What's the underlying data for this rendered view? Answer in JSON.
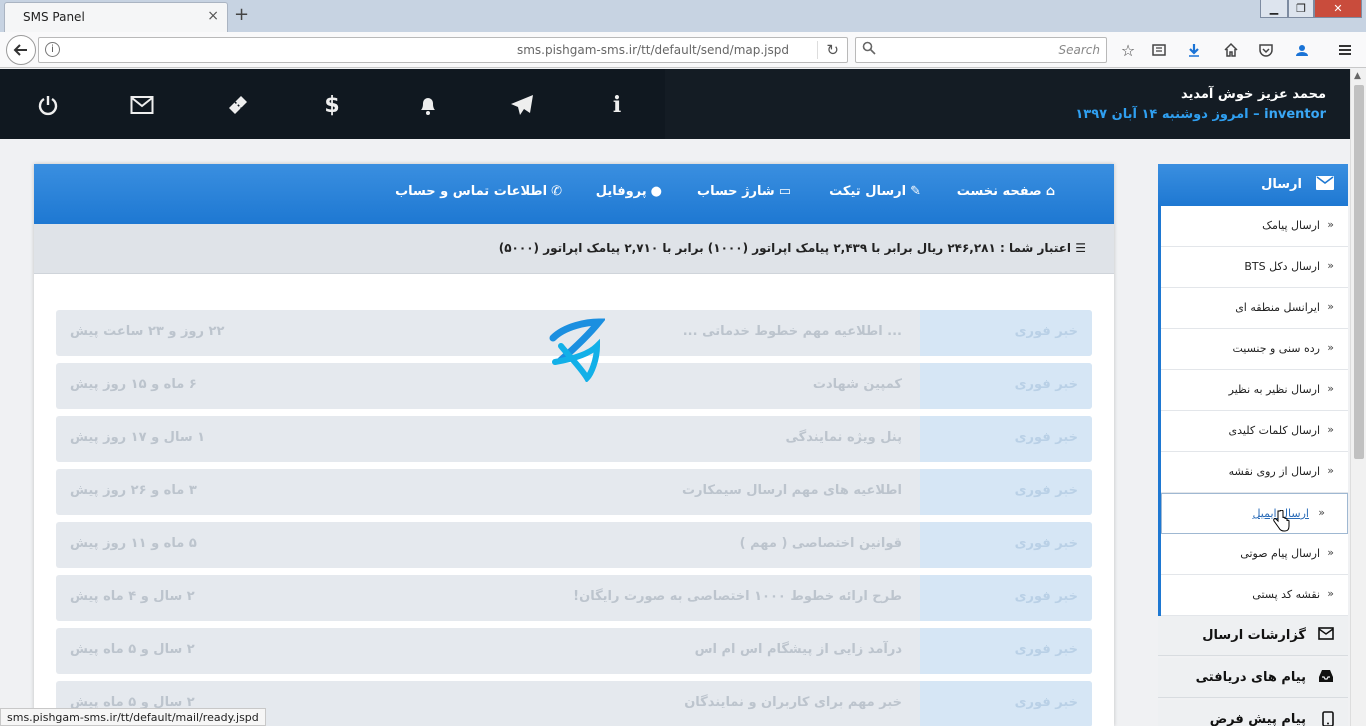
{
  "browser": {
    "tab_title": "SMS Panel",
    "tab_close": "×",
    "new_tab": "+",
    "url": "sms.pishgam-sms.ir/tt/default/send/map.jspd",
    "search_placeholder": "Search",
    "status_url": "sms.pishgam-sms.ir/tt/default/mail/ready.jspd"
  },
  "header": {
    "welcome": "محمد عزیز خوش آمدید",
    "username": "inventor",
    "date": "– امروز دوشنبه ۱۴ آبان ۱۳۹۷"
  },
  "topnav": {
    "home": "صفحه نخست",
    "ticket": "ارسال تیکت",
    "charge": "شارژ حساب",
    "profile": "پروفایل",
    "contact": "اطلاعات تماس و حساب"
  },
  "credit": {
    "text": "اعتبار شما : ۲۴۶,۲۸۱ ریال برابر با ۲,۴۳۹ پیامک اپراتور (۱۰۰۰) برابر با ۲,۷۱۰ پیامک اپراتور (۵۰۰۰)"
  },
  "news": [
    {
      "badge": "خبر فوری",
      "title": "... اطلاعیه مهم خطوط خدماتی ...",
      "time": "۲۲ روز و ۲۳ ساعت پیش"
    },
    {
      "badge": "خبر فوری",
      "title": "کمپین شهادت",
      "time": "۶ ماه و ۱۵ روز پیش"
    },
    {
      "badge": "خبر فوری",
      "title": "پنل ویژه نمایندگی",
      "time": "۱ سال و ۱۷ روز پیش"
    },
    {
      "badge": "خبر فوری",
      "title": "اطلاعیه های مهم ارسال سیمکارت",
      "time": "۳ ماه و ۲۶ روز پیش"
    },
    {
      "badge": "خبر فوری",
      "title": "قوانین اختصاصی ( مهم )",
      "time": "۵ ماه و ۱۱ روز پیش"
    },
    {
      "badge": "خبر فوری",
      "title": "طرح ارائه خطوط ۱۰۰۰ اختصاصی به صورت رایگان!",
      "time": "۲ سال و ۴ ماه پیش"
    },
    {
      "badge": "خبر فوری",
      "title": "درآمد زایی از پیشگام اس ام اس",
      "time": "۲ سال و ۵ ماه پیش"
    },
    {
      "badge": "خبر فوری",
      "title": "خبر مهم برای کاربران و نمایندگان",
      "time": "۲ سال و ۵ ماه پیش"
    }
  ],
  "sidebar": {
    "send_title": "ارسال",
    "items": [
      {
        "label": "ارسال پیامک"
      },
      {
        "label": "ارسال دکل BTS"
      },
      {
        "label": "ایرانسل منطقه ای"
      },
      {
        "label": "رده سنی و جنسیت"
      },
      {
        "label": "ارسال نظیر به نظیر"
      },
      {
        "label": "ارسال کلمات کلیدی"
      },
      {
        "label": "ارسال از روی نقشه"
      },
      {
        "label": "ارسال ایمیل"
      },
      {
        "label": "ارسال پیام صوتی"
      },
      {
        "label": "نقشه کد پستی"
      }
    ],
    "reports": "گزارشات ارسال",
    "received": "پیام های دریافتی",
    "defaults": "پیام پیش فرض"
  },
  "colors": {
    "accent": "#1e78d2",
    "header_bg": "#141c24",
    "date_text": "#2f9ff0"
  }
}
